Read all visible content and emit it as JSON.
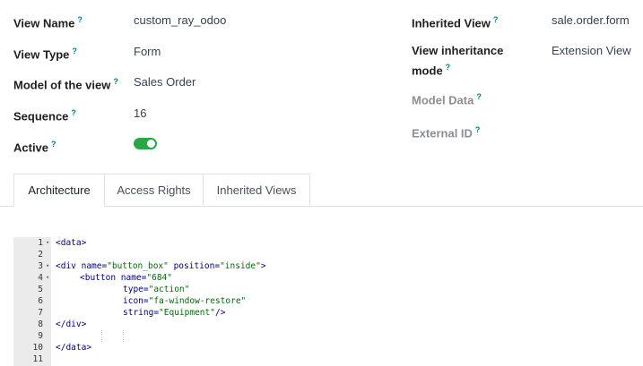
{
  "fields_left": [
    {
      "label": "View Name",
      "value": "custom_ray_odoo"
    },
    {
      "label": "View Type",
      "value": "Form"
    },
    {
      "label": "Model of the view",
      "value": "Sales Order"
    },
    {
      "label": "Sequence",
      "value": "16"
    },
    {
      "label": "Active",
      "value_state": "on"
    }
  ],
  "fields_right": [
    {
      "label": "Inherited View",
      "value": "sale.order.form"
    },
    {
      "label": "View inheritance mode",
      "label_line1": "View inheritance",
      "label_line2": "mode",
      "value": "Extension View"
    },
    {
      "label": "Model Data",
      "value": ""
    },
    {
      "label": "External ID",
      "value": ""
    }
  ],
  "tooltip_marker": "?",
  "tabs": [
    {
      "label": "Architecture",
      "active": true
    },
    {
      "label": "Access Rights",
      "active": false
    },
    {
      "label": "Inherited Views",
      "active": false
    }
  ],
  "editor": {
    "line_numbers": [
      "1",
      "2",
      "3",
      "4",
      "5",
      "6",
      "7",
      "8",
      "9",
      "10",
      "11"
    ],
    "fold_marker": "▾",
    "code": {
      "l1": "<data>",
      "l3_open": "<div ",
      "l3_attr1": "name=",
      "l3_val1": "\"button_box\"",
      "l3_attr2": " position=",
      "l3_val2": "\"inside\"",
      "l3_close": ">",
      "l4_open": "<button ",
      "l4_attr": "name=",
      "l4_val": "\"684\"",
      "l5_attr": "type=",
      "l5_val": "\"action\"",
      "l6_attr": "icon=",
      "l6_val": "\"fa-window-restore\"",
      "l7_attr": "string=",
      "l7_val": "\"Equipment\"",
      "l7_close": "/>",
      "l8": "</div>",
      "l10": "</data>"
    }
  },
  "colors": {
    "toggle_on": "#28a745",
    "tooltip": "#017e84",
    "code_tag": "#000080",
    "code_string": "#036a07",
    "gutter": "#ebebeb"
  }
}
